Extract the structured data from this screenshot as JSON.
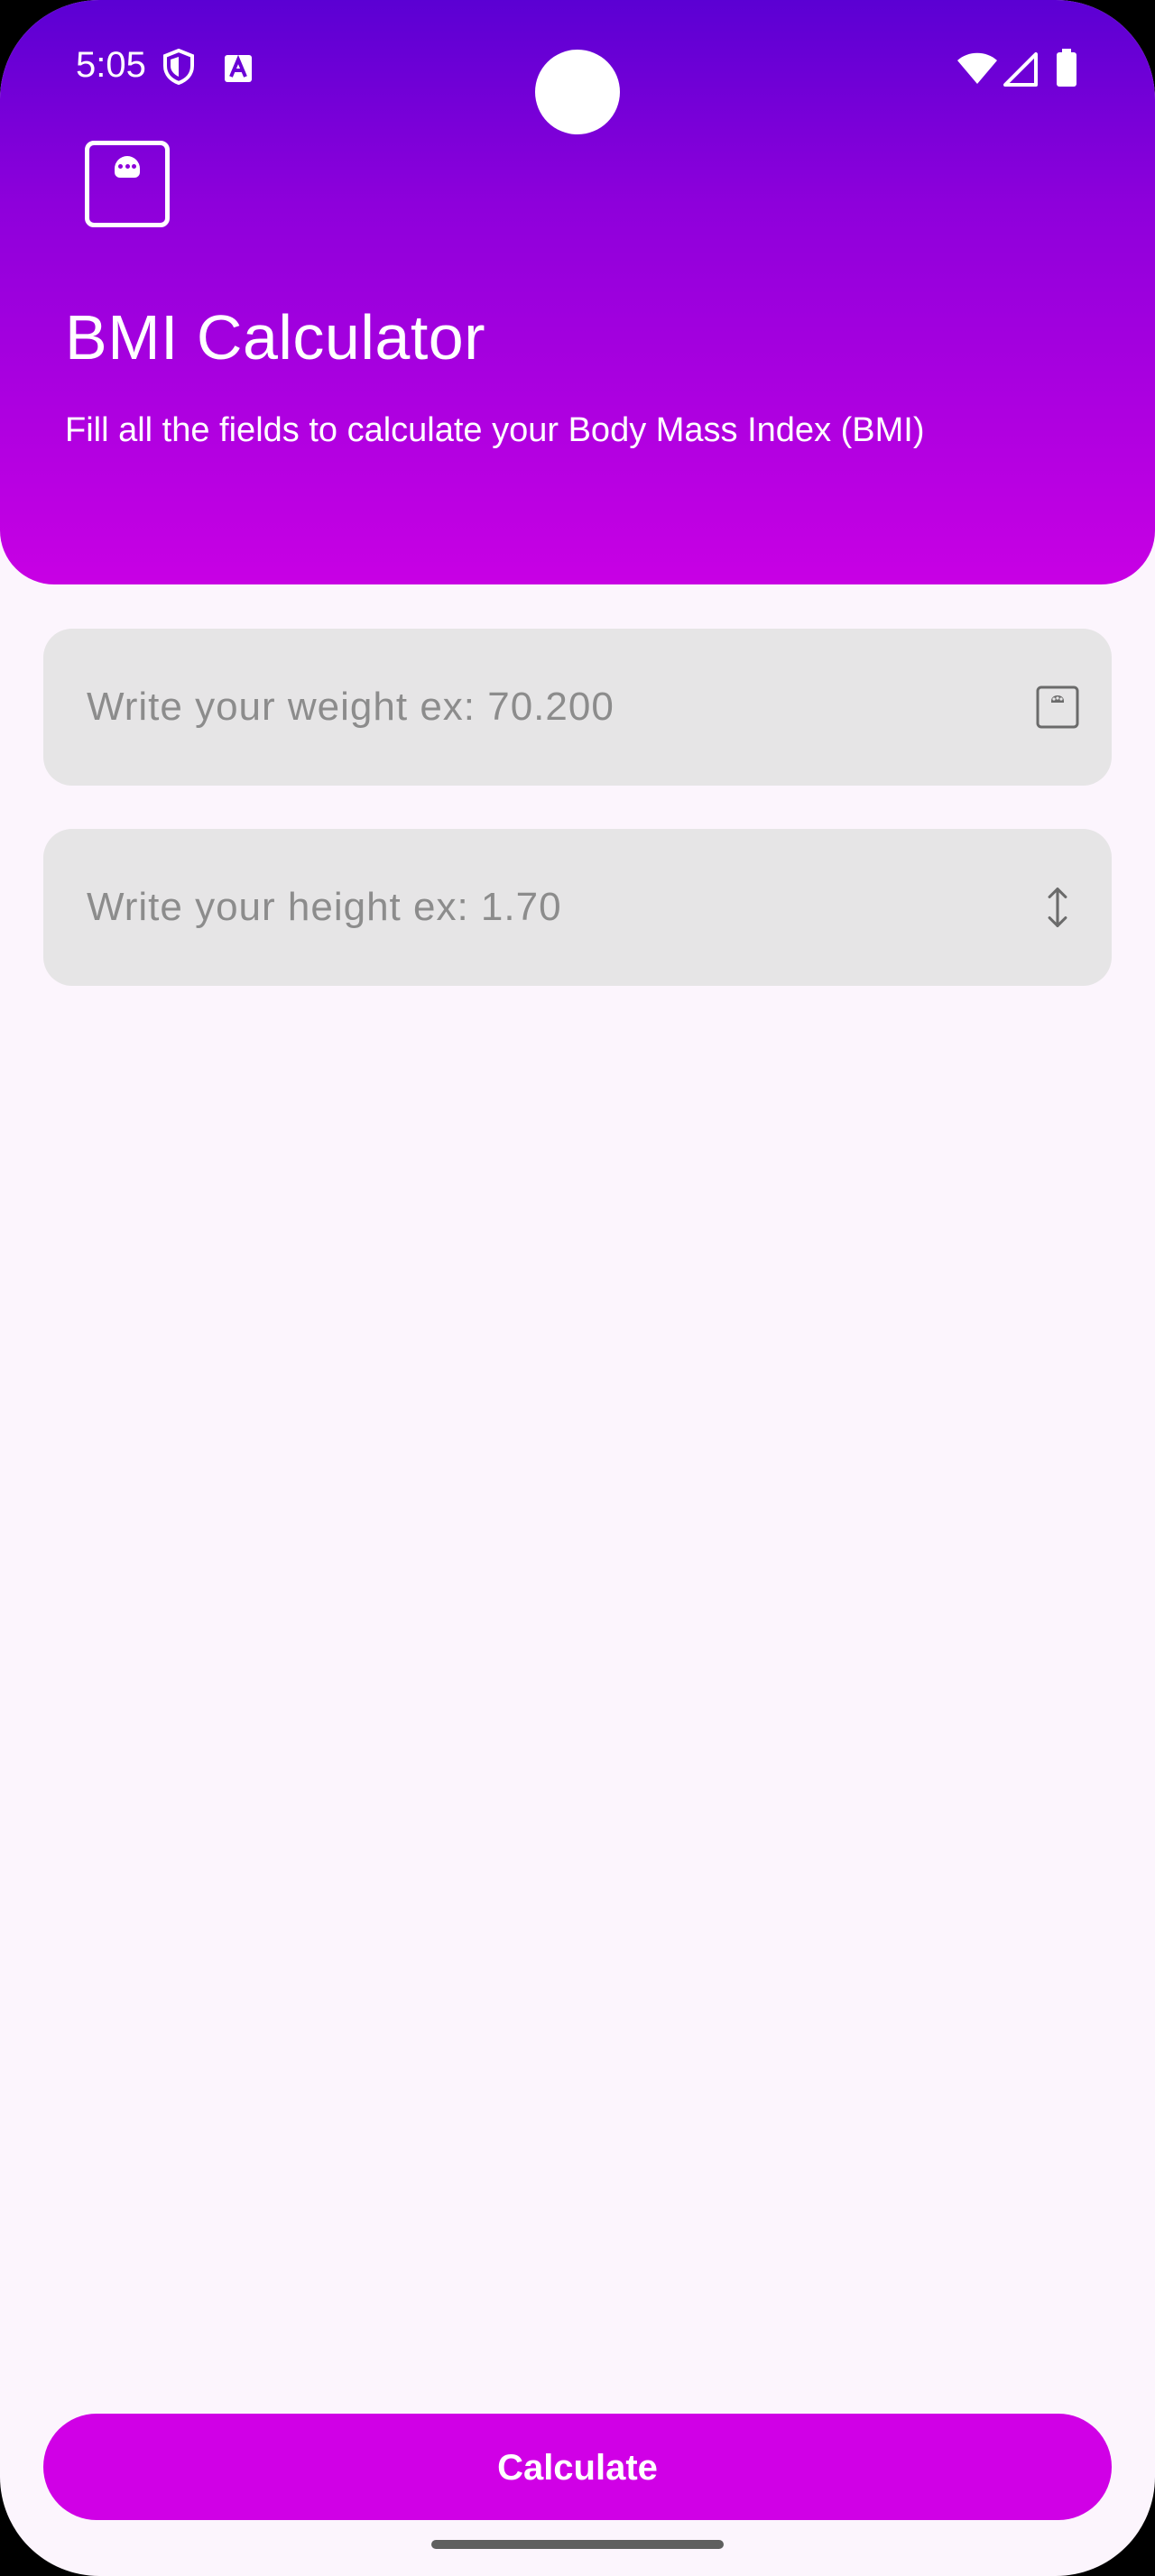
{
  "status_bar": {
    "time": "5:05",
    "left_icons": [
      "shield-icon",
      "font-a-icon"
    ],
    "right_icons": [
      "wifi-icon",
      "cell-signal-icon",
      "battery-icon"
    ]
  },
  "header": {
    "title": "BMI Calculator",
    "subtitle": "Fill all the fields to calculate your Body Mass Index (BMI)",
    "logo_icon": "scale-icon",
    "gradient_colors": [
      "#5b00d3",
      "#8e00db",
      "#c800e4"
    ]
  },
  "form": {
    "weight": {
      "placeholder": "Write your weight ex: 70.200",
      "value": "",
      "trailing_icon": "scale-icon"
    },
    "height": {
      "placeholder": "Write your height ex: 1.70",
      "value": "",
      "trailing_icon": "vertical-arrows-icon"
    }
  },
  "actions": {
    "calculate_label": "Calculate",
    "calculate_color": "#d000e6"
  },
  "theme": {
    "background": "#fcf5fd",
    "field_background": "#e6e5e6"
  }
}
